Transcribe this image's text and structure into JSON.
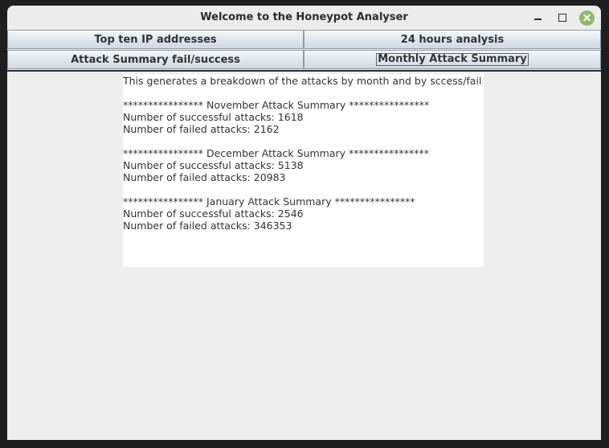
{
  "window": {
    "title": "Welcome to the Honeypot Analyser"
  },
  "controls": {
    "minimize_icon": "minimize-icon",
    "maximize_icon": "maximize-icon",
    "close_icon": "close-icon",
    "close_color": "#8fb96a"
  },
  "buttons": {
    "top_ten": "Top ten IP addresses",
    "hours_24": "24 hours analysis",
    "summary_fail_success": "Attack Summary fail/success",
    "monthly_summary": "Monthly Attack Summary"
  },
  "output": {
    "intro": "This generates a breakdown of the attacks by month and by sccess/fail",
    "months": [
      {
        "header": "**************** November Attack Summary ****************",
        "successful": "Number of successful attacks: 1618",
        "failed": "Number of failed attacks: 2162"
      },
      {
        "header": "**************** December Attack Summary ****************",
        "successful": "Number of successful attacks: 5138",
        "failed": "Number of failed attacks: 20983"
      },
      {
        "header": "**************** January Attack Summary ****************",
        "successful": "Number of successful attacks: 2546",
        "failed": "Number of failed attacks: 346353"
      }
    ]
  }
}
